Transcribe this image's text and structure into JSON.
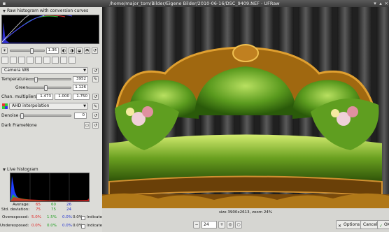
{
  "window": {
    "title": "/home/major_tom/Bilder/Eigene Bilder/2010-06-16/DSC_9409.NEF - UFRaw"
  },
  "raw_histogram": {
    "title": "Raw histogram with conversion curves",
    "exposure_value": "1.36"
  },
  "white_balance": {
    "preset": "Camera WB",
    "temperature_label": "Temperature",
    "temperature_value": "3952",
    "green_label": "Green",
    "green_value": "1.126",
    "chan_label": "Chan. multipliers:",
    "chan_values": [
      "1.473",
      "1.000",
      "1.750"
    ]
  },
  "interpolation": {
    "value": "AHD interpolation"
  },
  "denoise": {
    "label": "Denoise",
    "value": "0"
  },
  "dark_frame": {
    "label": "Dark Frame:",
    "value": "None"
  },
  "live_histogram": {
    "title": "Live histogram",
    "average_label": "Average:",
    "average": [
      "65",
      "60",
      "26"
    ],
    "stddev_label": "Std. deviation:",
    "stddev": [
      "75",
      "75",
      "24"
    ],
    "overexposed_label": "Overexposed:",
    "overexposed": [
      "5.0%",
      "1.5%",
      "0.0%"
    ],
    "overexposed_extra": "0.0%",
    "underexposed_label": "Underexposed:",
    "underexposed": [
      "0.0%",
      "0.0%",
      "0.0%"
    ],
    "underexposed_extra": "0.0%",
    "indicate_label": "Indicate",
    "colors": {
      "red": "#e02020",
      "green": "#20a020",
      "blue": "#2030d0"
    }
  },
  "status": {
    "text": "size 3900x2613, zoom 24%"
  },
  "zoom": {
    "value": "24"
  },
  "buttons": {
    "options": "Options",
    "cancel": "Cancel",
    "ok": "OK"
  }
}
